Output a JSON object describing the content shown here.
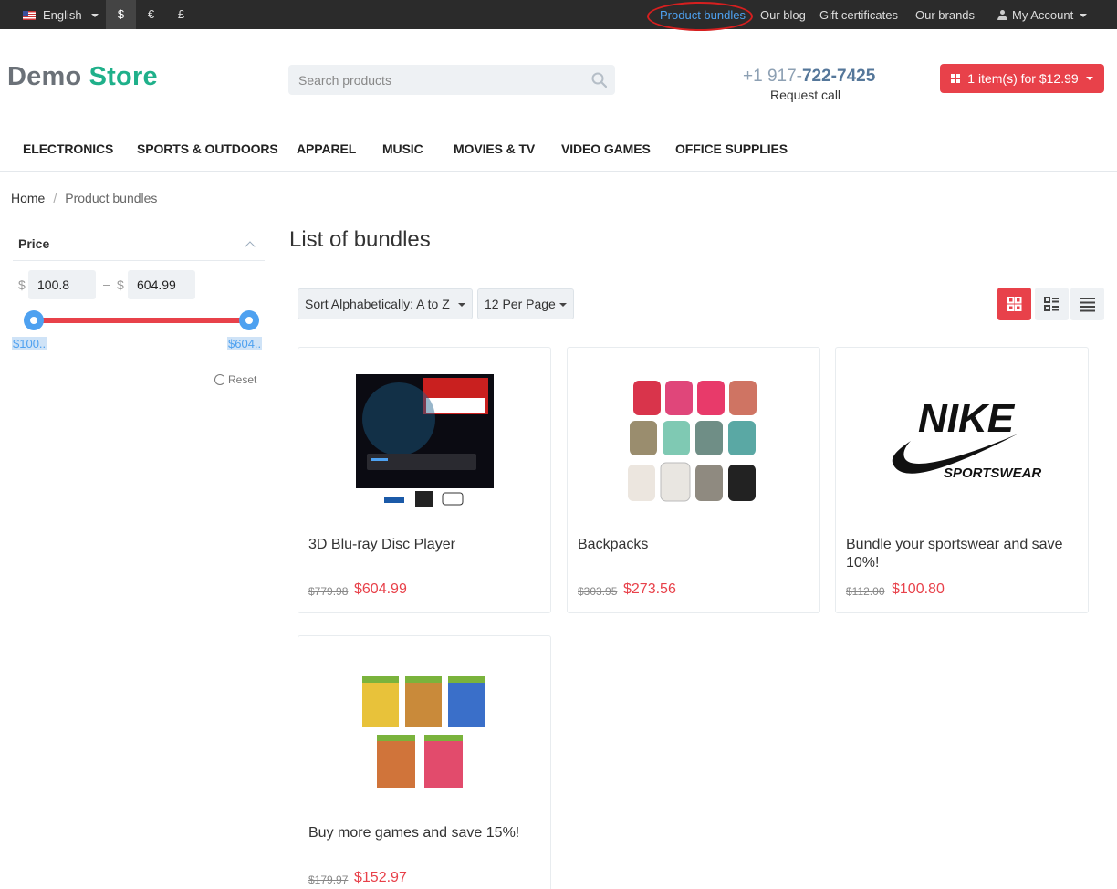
{
  "topbar": {
    "language": "English",
    "currencies": [
      "$",
      "€",
      "£"
    ],
    "links": [
      "Product bundles",
      "Our blog",
      "Gift certificates",
      "Our brands"
    ],
    "account": "My Account"
  },
  "header": {
    "logo_part1": "Demo",
    "logo_part2": "Store",
    "search_placeholder": "Search products",
    "phone_prefix": "+1 917-",
    "phone_main": "722-7425",
    "request_call": "Request call",
    "cart_label": "1 item(s) for $12.99"
  },
  "nav": [
    "ELECTRONICS",
    "SPORTS & OUTDOORS",
    "APPAREL",
    "MUSIC",
    "MOVIES & TV",
    "VIDEO GAMES",
    "OFFICE SUPPLIES"
  ],
  "breadcrumb": {
    "home": "Home",
    "sep": "/",
    "current": "Product bundles"
  },
  "filter": {
    "title": "Price",
    "currency": "$",
    "dash": "–",
    "min": "100.8",
    "max": "604.99",
    "min_label": "$100..",
    "max_label": "$604..",
    "reset": "Reset"
  },
  "main": {
    "title": "List of bundles",
    "sort": "Sort Alphabetically: A to Z",
    "per_page": "12 Per Page"
  },
  "products": [
    {
      "name": "3D Blu-ray Disc Player",
      "old_price": "$779.98",
      "price": "$604.99"
    },
    {
      "name": "Backpacks",
      "old_price": "$303.95",
      "price": "$273.56"
    },
    {
      "name": "Bundle your sportswear and save 10%!",
      "old_price": "$112.00",
      "price": "$100.80"
    },
    {
      "name": "Buy more games and save 15%!",
      "old_price": "$179.97",
      "price": "$152.97"
    }
  ],
  "colors": {
    "accent": "#e8414a",
    "brand_green": "#1fb08a",
    "link_blue": "#4ea1f0",
    "topbar": "#2b2b2b"
  }
}
